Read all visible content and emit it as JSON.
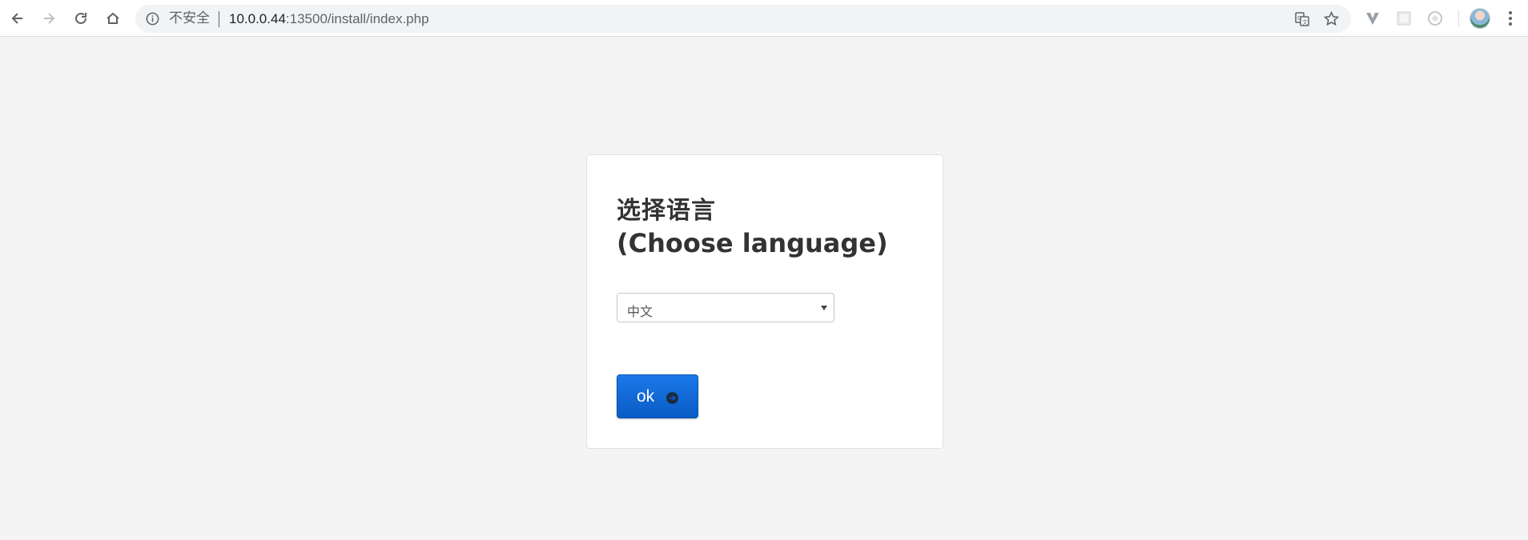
{
  "browser": {
    "security_label": "不安全",
    "url_host": "10.0.0.44",
    "url_rest": ":13500/install/index.php",
    "icons": [
      "back-icon",
      "forward-icon",
      "reload-icon",
      "home-icon",
      "info-icon",
      "translate-icon",
      "star-icon",
      "extension-icon",
      "avatar",
      "menu-icon"
    ]
  },
  "page": {
    "title_zh": "选择语言",
    "title_en": "(Choose language)",
    "language_select": {
      "selected": "中文"
    },
    "ok_button_label": "ok",
    "colors": {
      "background": "#f4f4f4",
      "card": "#ffffff",
      "button": "#0a5cc5",
      "title": "#333333"
    }
  }
}
